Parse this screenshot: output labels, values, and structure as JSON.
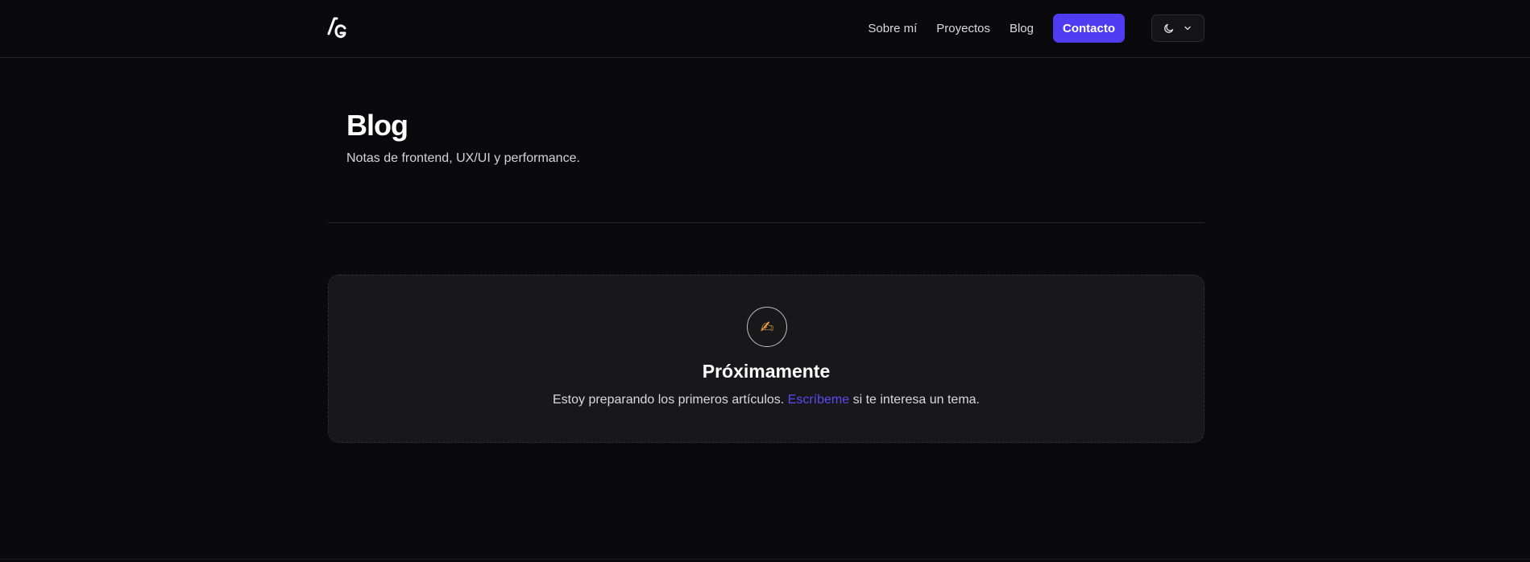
{
  "header": {
    "logo_text": "AG",
    "nav": {
      "about": "Sobre mí",
      "projects": "Proyectos",
      "blog": "Blog",
      "contact": "Contacto"
    },
    "theme_toggle": {
      "icon": "moon-icon",
      "dropdown_icon": "chevron-down-icon"
    }
  },
  "page": {
    "title": "Blog",
    "subtitle": "Notas de frontend, UX/UI y performance."
  },
  "empty_state": {
    "icon": "✍",
    "title": "Próximamente",
    "text_before": "Estoy preparando los primeros artículos. ",
    "link": "Escríbeme",
    "text_after": " si te interesa un tema."
  },
  "colors": {
    "background": "#0a0a0c",
    "accent": "#4f3cf0",
    "card": "#18181b"
  }
}
